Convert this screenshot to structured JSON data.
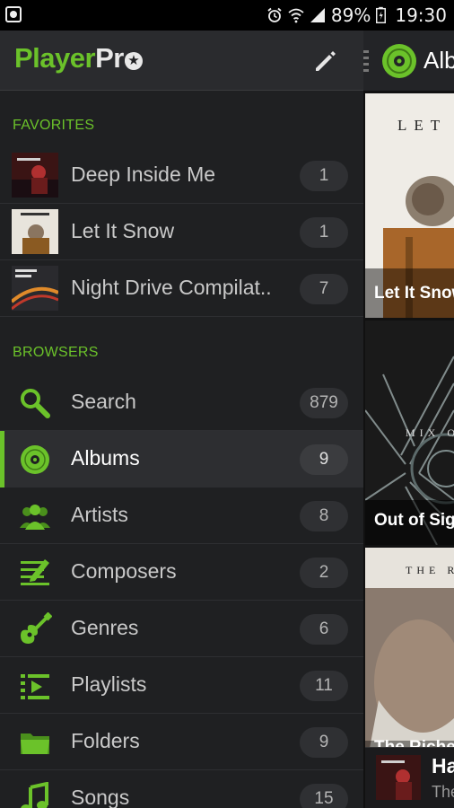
{
  "status_bar": {
    "battery": "89%",
    "time": "19:30",
    "icons": [
      "screen-record-icon",
      "alarm-icon",
      "wifi-icon",
      "signal-icon",
      "battery-icon"
    ]
  },
  "drawer": {
    "logo_player": "Player",
    "logo_pro": "Pro",
    "edit_icon": "pencil-icon",
    "favorites_title": "FAVORITES",
    "favorites": [
      {
        "label": "Deep Inside Me",
        "count": "1"
      },
      {
        "label": "Let It Snow",
        "count": "1"
      },
      {
        "label": "Night Drive Compilat..",
        "count": "7"
      }
    ],
    "browsers_title": "BROWSERS",
    "browsers": [
      {
        "label": "Search",
        "count": "879",
        "icon": "search-icon"
      },
      {
        "label": "Albums",
        "count": "9",
        "icon": "album-icon",
        "active": true
      },
      {
        "label": "Artists",
        "count": "8",
        "icon": "artists-icon"
      },
      {
        "label": "Composers",
        "count": "2",
        "icon": "composers-icon"
      },
      {
        "label": "Genres",
        "count": "6",
        "icon": "guitar-icon"
      },
      {
        "label": "Playlists",
        "count": "11",
        "icon": "playlist-icon"
      },
      {
        "label": "Folders",
        "count": "9",
        "icon": "folder-icon"
      },
      {
        "label": "Songs",
        "count": "15",
        "icon": "music-note-icon"
      }
    ]
  },
  "content": {
    "title": "Alb",
    "tiles": [
      {
        "label": "Let It Snow",
        "cover_text": "LET I"
      },
      {
        "label": "Out of Sig",
        "cover_text": "MIX OF EXTRAORD"
      },
      {
        "label": "The Riche",
        "cover_text": "THE R"
      }
    ],
    "now_playing": {
      "title": "Ha",
      "subtitle": "The"
    }
  },
  "colors": {
    "accent": "#6bc22a",
    "background": "#1f2022",
    "header": "#2a2b2e"
  }
}
